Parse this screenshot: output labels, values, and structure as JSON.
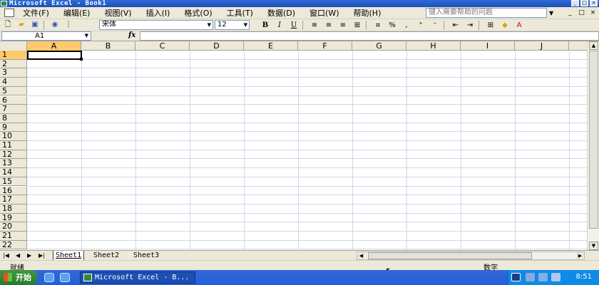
{
  "window": {
    "title": "Microsoft Excel - Book1",
    "controls": [
      "_",
      "□",
      "×"
    ]
  },
  "menu": {
    "items": [
      "文件(F)",
      "编辑(E)",
      "视图(V)",
      "插入(I)",
      "格式(O)",
      "工具(T)",
      "数据(D)",
      "窗口(W)",
      "帮助(H)"
    ],
    "help_placeholder": "键入需要帮助的问题",
    "doc_controls": [
      "_",
      "□",
      "×"
    ]
  },
  "toolbar": {
    "font": "宋体",
    "size": "12",
    "bold": "B",
    "italic": "I",
    "underline": "U",
    "percent": "%"
  },
  "formula_bar": {
    "name_box": "A1",
    "fx": "fx",
    "value": ""
  },
  "grid": {
    "columns": [
      "A",
      "B",
      "C",
      "D",
      "E",
      "F",
      "G",
      "H",
      "I",
      "J"
    ],
    "rows": [
      "1",
      "2",
      "3",
      "4",
      "5",
      "6",
      "7",
      "8",
      "9",
      "10",
      "11",
      "12",
      "13",
      "14",
      "15",
      "16",
      "17",
      "18",
      "19",
      "20",
      "21",
      "22"
    ],
    "active_cell": "A1"
  },
  "sheets": {
    "tabs": [
      "Sheet1",
      "Sheet2",
      "Sheet3"
    ],
    "active": "Sheet1"
  },
  "status": {
    "ready": "就绪",
    "mode": "数字"
  },
  "taskbar": {
    "start": "开始",
    "task": "Microsoft Excel - B...",
    "clock": "8:51"
  },
  "colors": {
    "title_bar": "#1d4fb8",
    "chrome": "#ece9d8",
    "selected_header": "#ffc96b",
    "gridline": "#d0d7e5",
    "taskbar": "#245edb",
    "start_button": "#3c9a3c"
  }
}
